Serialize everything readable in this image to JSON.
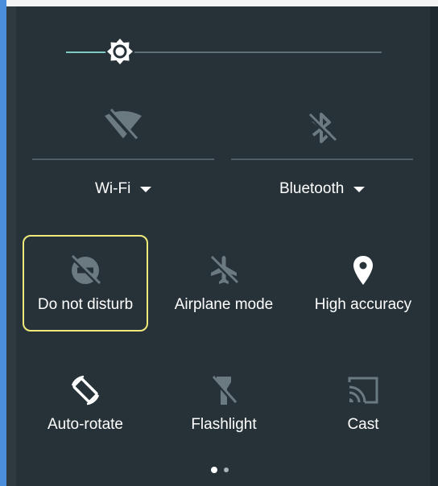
{
  "brightness": {
    "level": 0.17,
    "icon": "brightness-icon"
  },
  "wifi": {
    "label": "Wi-Fi",
    "icon": "wifi-off-icon"
  },
  "bluetooth": {
    "label": "Bluetooth",
    "icon": "bluetooth-off-icon"
  },
  "tiles": [
    {
      "label": "Do not disturb",
      "icon": "do-not-disturb-icon",
      "active": false,
      "highlighted": true
    },
    {
      "label": "Airplane mode",
      "icon": "airplane-off-icon",
      "active": false
    },
    {
      "label": "High accuracy",
      "icon": "location-icon",
      "active": true
    },
    {
      "label": "Auto-rotate",
      "icon": "auto-rotate-icon",
      "active": true
    },
    {
      "label": "Flashlight",
      "icon": "flashlight-off-icon",
      "active": false
    },
    {
      "label": "Cast",
      "icon": "cast-icon",
      "active": false
    }
  ],
  "pager": {
    "current_page": 1,
    "total_pages": 2
  },
  "colors": {
    "panel": "#263238",
    "accent": "#7fcbc4",
    "highlight": "#f0ea7a",
    "icon_off": "#6b7a80"
  }
}
